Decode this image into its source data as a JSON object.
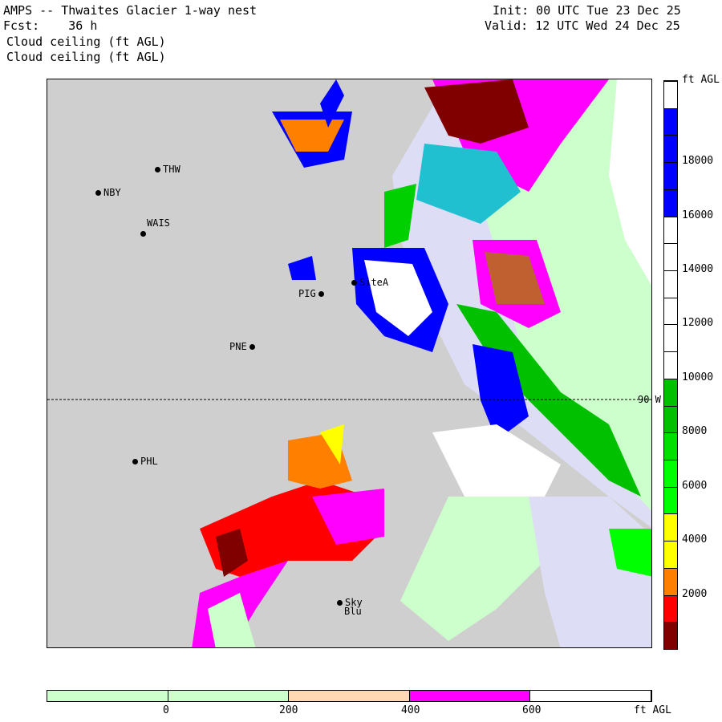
{
  "header": {
    "title": "AMPS -- Thwaites Glacier 1-way nest",
    "fcst": "Fcst:    36 h",
    "field1": "Cloud ceiling (ft AGL)",
    "field2": "Cloud ceiling (ft AGL)",
    "init": "Init: 00 UTC Tue 23 Dec 25",
    "valid": "Valid: 12 UTC Wed 24 Dec 25"
  },
  "stations": [
    {
      "name": "THW"
    },
    {
      "name": "NBY"
    },
    {
      "name": "WAIS"
    },
    {
      "name": "PIG"
    },
    {
      "name": "SiteA"
    },
    {
      "name": "PNE"
    },
    {
      "name": "PHL"
    },
    {
      "name": "Sky"
    },
    {
      "name": "Blu"
    }
  ],
  "meridian_label": "90 W",
  "colorbar": {
    "unit": "ft AGL",
    "labels": [
      "18000",
      "16000",
      "14000",
      "12000",
      "10000",
      "8000",
      "6000",
      "4000",
      "2000"
    ],
    "colors_bottom_up": [
      "#800000",
      "#ff0000",
      "#ff8000",
      "#ffff00",
      "#ffff00",
      "#00ff00",
      "#00ff00",
      "#00e000",
      "#00c000",
      "#00c000",
      "#ffffff",
      "#ffffff",
      "#ffffff",
      "#ffffff",
      "#ffffff",
      "#ffffff",
      "#0000ff",
      "#0000ff",
      "#0000ff",
      "#0000ff",
      "#ffffff"
    ]
  },
  "low_colorbar": {
    "unit": "ft AGL",
    "labels": [
      "0",
      "200",
      "400",
      "600"
    ],
    "colors": [
      "#ccffcc",
      "#ccffcc",
      "#ffd9b3",
      "#ff00ff",
      "#ffffff"
    ]
  }
}
